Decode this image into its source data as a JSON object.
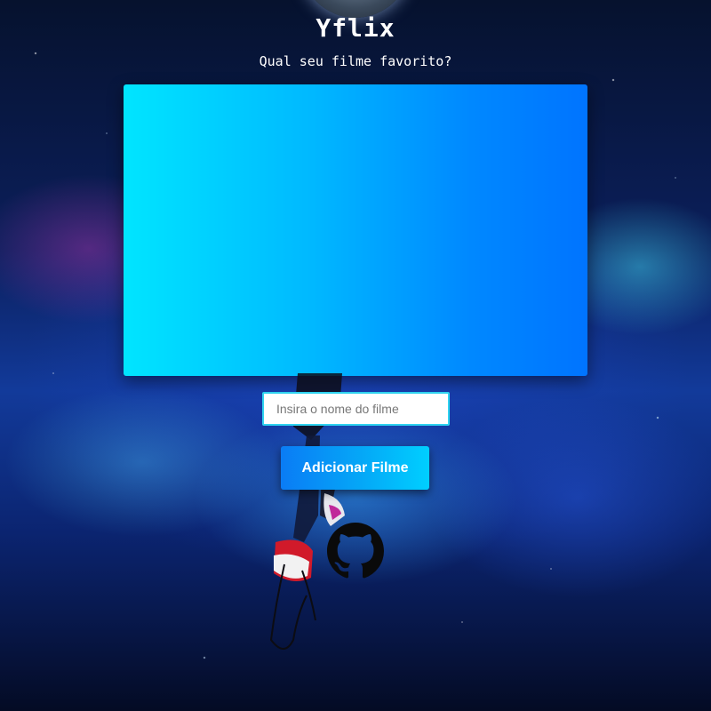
{
  "header": {
    "title": "Yflix",
    "subtitle": "Qual seu filme favorito?"
  },
  "form": {
    "input_placeholder": "Insira o nome do filme",
    "input_value": "",
    "add_button_label": "Adicionar Filme"
  },
  "icons": {
    "github": "github-icon"
  },
  "colors": {
    "panel_start": "#00e5ff",
    "panel_end": "#0074ff",
    "button_start": "#0a7cf5",
    "button_end": "#00cfff",
    "input_border": "#2fd3f0"
  }
}
